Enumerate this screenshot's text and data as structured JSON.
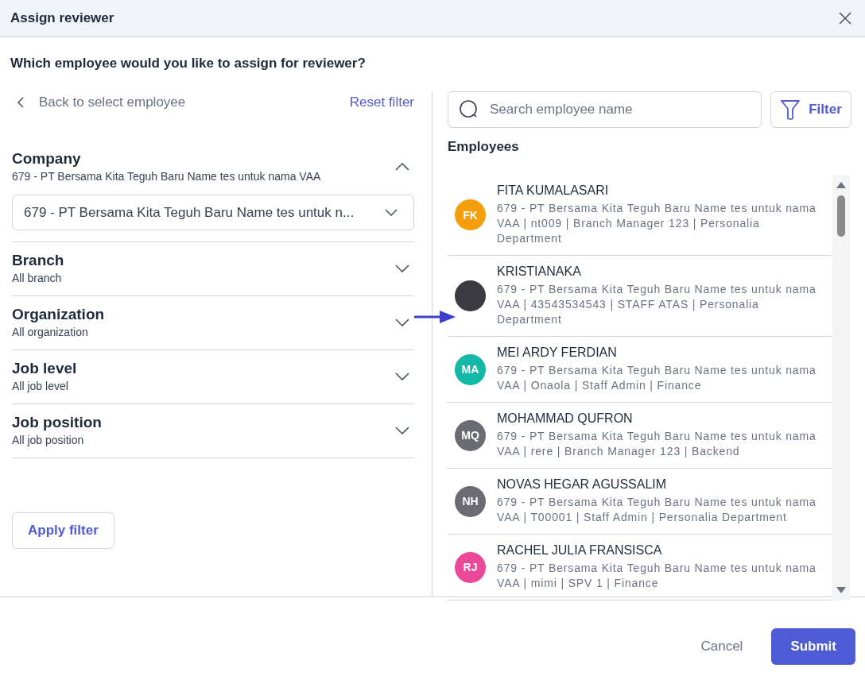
{
  "dialog": {
    "title": "Assign reviewer"
  },
  "question": "Which employee would you like to assign for reviewer?",
  "filter_panel": {
    "back_link": "Back to select employee",
    "reset_link": "Reset filter",
    "sections": [
      {
        "title": "Company",
        "value": "679 - PT Bersama Kita Teguh Baru Name tes untuk nama VAA",
        "expanded": true,
        "select_value": "679 - PT Bersama Kita Teguh Baru Name tes untuk n..."
      },
      {
        "title": "Branch",
        "value": "All branch",
        "expanded": false
      },
      {
        "title": "Organization",
        "value": "All organization",
        "expanded": false
      },
      {
        "title": "Job level",
        "value": "All job level",
        "expanded": false
      },
      {
        "title": "Job position",
        "value": "All job position",
        "expanded": false
      }
    ],
    "apply_button": "Apply filter"
  },
  "search": {
    "placeholder": "Search employee name"
  },
  "filter_button": "Filter",
  "employees_heading": "Employees",
  "employees": [
    {
      "name": "FITA KUMALASARI",
      "kind": "initials",
      "initials": "FK",
      "color": "#f59e0b",
      "details": "679 - PT Bersama Kita Teguh Baru Name tes untuk nama VAA | nt009 | Branch Manager 123 | Personalia Department"
    },
    {
      "name": "KRISTIANAKA",
      "kind": "photo",
      "details": "679 - PT Bersama Kita Teguh Baru Name tes untuk nama VAA | 43543534543 | STAFF ATAS | Personalia Department"
    },
    {
      "name": "MEI ARDY FERDIAN",
      "kind": "initials",
      "initials": "MA",
      "color": "#14b8a6",
      "details": "679 - PT Bersama Kita Teguh Baru Name tes untuk nama VAA | Onaola | Staff Admin | Finance"
    },
    {
      "name": "MOHAMMAD QUFRON",
      "kind": "initials",
      "initials": "MQ",
      "color": "#6b6b73",
      "details": "679 - PT Bersama Kita Teguh Baru Name tes untuk nama VAA | rere | Branch Manager 123 | Backend"
    },
    {
      "name": "NOVAS HEGAR AGUSSALIM",
      "kind": "initials",
      "initials": "NH",
      "color": "#6b6b73",
      "details": "679 - PT Bersama Kita Teguh Baru Name tes untuk nama VAA | T00001 | Staff Admin | Personalia Department"
    },
    {
      "name": "RACHEL JULIA FRANSISCA",
      "kind": "initials",
      "initials": "RJ",
      "color": "#ec4899",
      "details": "679 - PT Bersama Kita Teguh Baru Name tes untuk nama VAA | mimi | SPV 1 | Finance"
    }
  ],
  "footer": {
    "cancel": "Cancel",
    "submit": "Submit"
  }
}
